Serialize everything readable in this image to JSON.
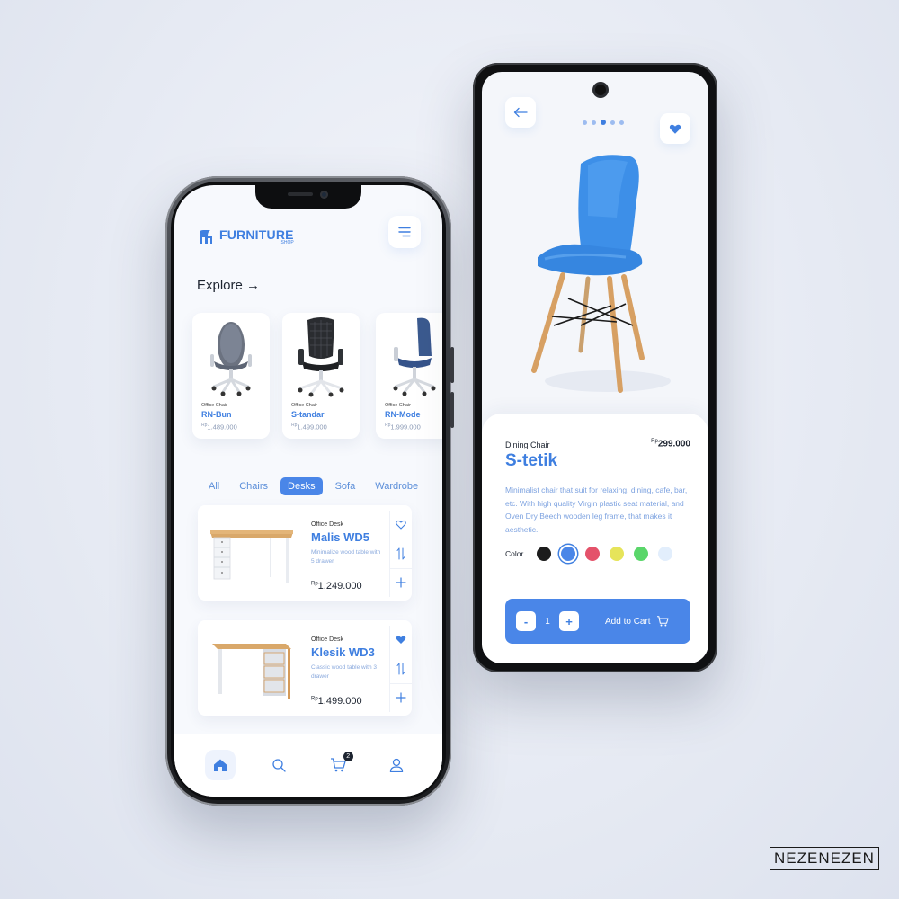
{
  "left_phone": {
    "brand": {
      "name": "FURNITURE",
      "sub": "SHOP",
      "logo_icon": "chair-logo-icon"
    },
    "explore_label": "Explore →",
    "featured": [
      {
        "category": "Office Chair",
        "name": "RN-Bun",
        "currency": "Rp",
        "price": "1.489.000"
      },
      {
        "category": "Office Chair",
        "name": "S-tandar",
        "currency": "Rp",
        "price": "1.499.000"
      },
      {
        "category": "Office Chair",
        "name": "RN-Mode",
        "currency": "Rp",
        "price": "1.999.000"
      }
    ],
    "tabs": [
      {
        "label": "All",
        "active": false
      },
      {
        "label": "Chairs",
        "active": false
      },
      {
        "label": "Desks",
        "active": true
      },
      {
        "label": "Sofa",
        "active": false
      },
      {
        "label": "Wardrobe",
        "active": false
      }
    ],
    "products": [
      {
        "category": "Office Desk",
        "name": "Malis WD5",
        "desc": "Minimalize wood table with 5 drawer",
        "currency": "Rp",
        "price": "1.249.000",
        "favorited": false
      },
      {
        "category": "Office Desk",
        "name": "Klesik WD3",
        "desc": "Classic wood table with 3 drawer",
        "currency": "Rp",
        "price": "1.499.000",
        "favorited": true
      }
    ],
    "nav": {
      "cart_count": "2",
      "items": [
        "home-icon",
        "search-icon",
        "cart-icon",
        "profile-icon"
      ]
    }
  },
  "right_phone": {
    "category": "Dining Chair",
    "name": "S-tetik",
    "currency": "Rp",
    "price": "299.000",
    "description": "Minimalist chair that suit for relaxing, dining, cafe, bar, etc. With high quality Virgin plastic seat material, and Oven Dry Beech wooden leg frame, that makes it aesthetic.",
    "color_label": "Color",
    "colors": [
      "#1c1c1c",
      "#4a86e8",
      "#e4526a",
      "#e6e45a",
      "#5ad66a",
      "#e2eefc"
    ],
    "selected_color_index": 1,
    "quantity": "1",
    "minus_label": "-",
    "plus_label": "+",
    "add_to_cart_label": "Add to Cart",
    "image_dots": 5,
    "active_dot": 3
  },
  "watermark": "NEZENEZEN",
  "accent": "#4a86e8"
}
